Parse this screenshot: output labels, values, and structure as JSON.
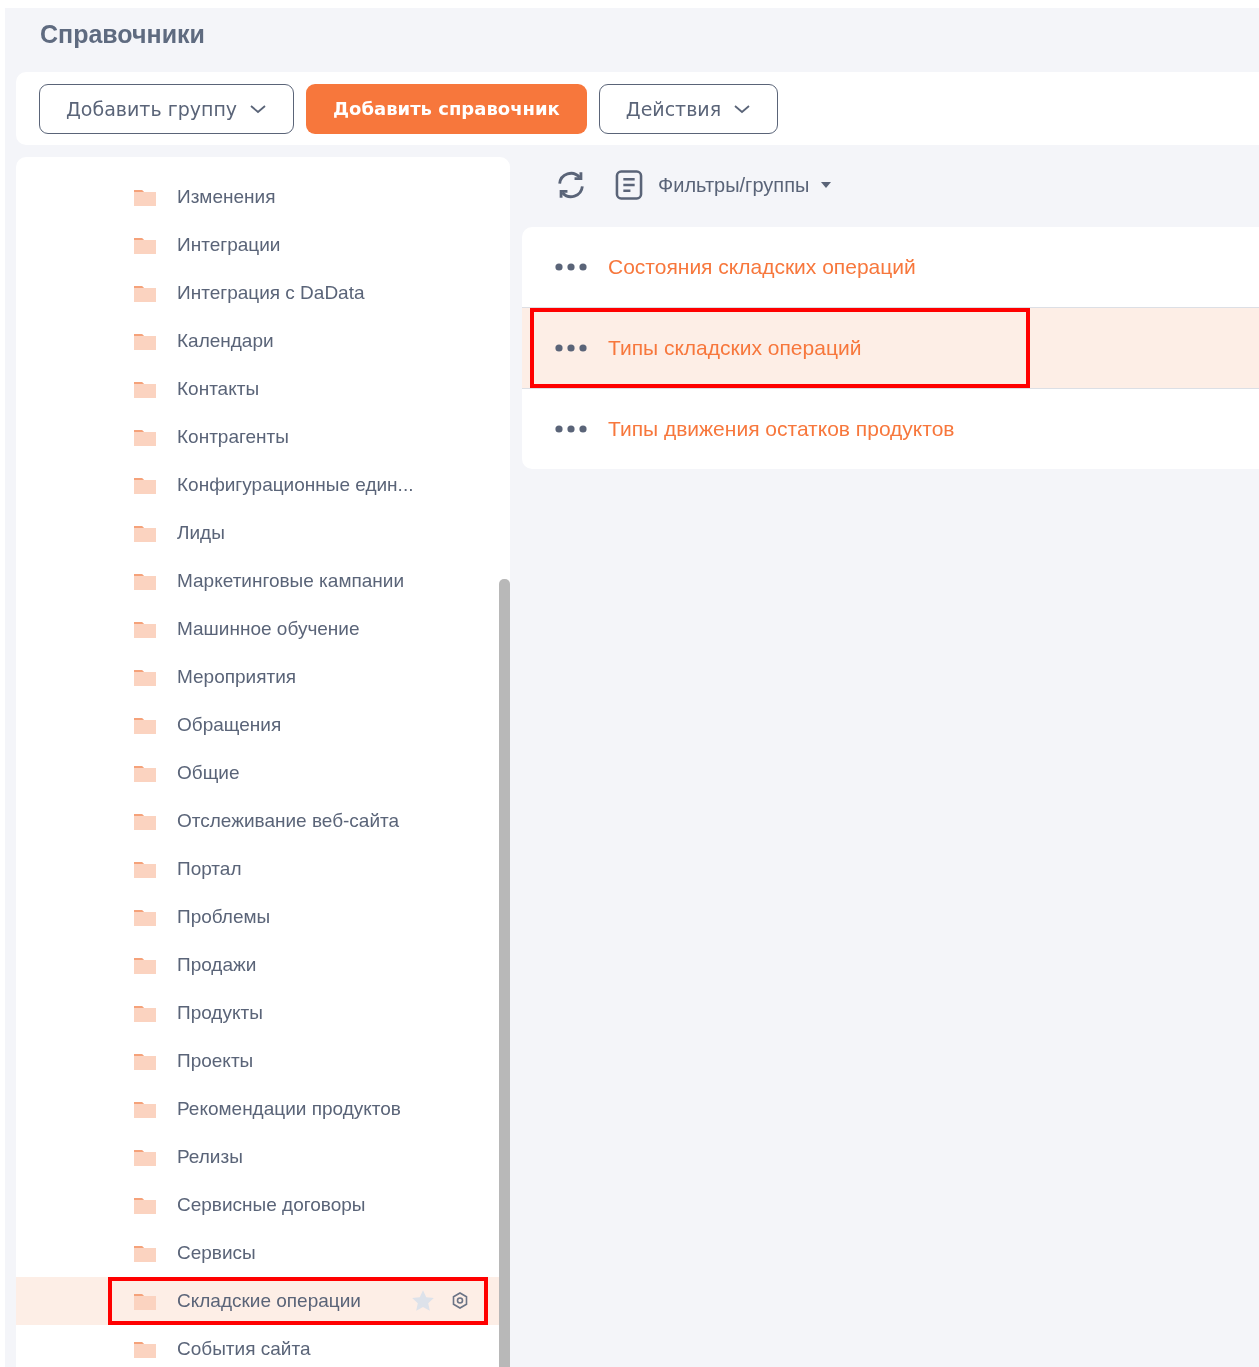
{
  "page": {
    "title": "Справочники"
  },
  "toolbar": {
    "buttons": [
      {
        "label": "Добавить группу",
        "kind": "dropdown"
      },
      {
        "label": "Добавить справочник",
        "kind": "primary"
      },
      {
        "label": "Действия",
        "kind": "dropdown"
      }
    ]
  },
  "sidebar": {
    "items": [
      {
        "label": "Изменения",
        "selected": false
      },
      {
        "label": "Интеграции",
        "selected": false
      },
      {
        "label": "Интеграция с DaData",
        "selected": false
      },
      {
        "label": "Календари",
        "selected": false
      },
      {
        "label": "Контакты",
        "selected": false
      },
      {
        "label": "Контрагенты",
        "selected": false
      },
      {
        "label": "Конфигурационные един...",
        "selected": false
      },
      {
        "label": "Лиды",
        "selected": false
      },
      {
        "label": "Маркетинговые кампании",
        "selected": false
      },
      {
        "label": "Машинное обучение",
        "selected": false
      },
      {
        "label": "Мероприятия",
        "selected": false
      },
      {
        "label": "Обращения",
        "selected": false
      },
      {
        "label": "Общие",
        "selected": false
      },
      {
        "label": "Отслеживание веб-сайта",
        "selected": false
      },
      {
        "label": "Портал",
        "selected": false
      },
      {
        "label": "Проблемы",
        "selected": false
      },
      {
        "label": "Продажи",
        "selected": false
      },
      {
        "label": "Продукты",
        "selected": false
      },
      {
        "label": "Проекты",
        "selected": false
      },
      {
        "label": "Рекомендации продуктов",
        "selected": false
      },
      {
        "label": "Релизы",
        "selected": false
      },
      {
        "label": "Сервисные договоры",
        "selected": false
      },
      {
        "label": "Сервисы",
        "selected": false
      },
      {
        "label": "Складские операции",
        "selected": true
      },
      {
        "label": "События сайта",
        "selected": false
      }
    ]
  },
  "content": {
    "filter_label": "Фильтры/группы",
    "rows": [
      {
        "label": "Состояния складских операций",
        "selected": false
      },
      {
        "label": "Типы складских операций",
        "selected": true
      },
      {
        "label": "Типы движения остатков продуктов",
        "selected": false
      }
    ]
  }
}
